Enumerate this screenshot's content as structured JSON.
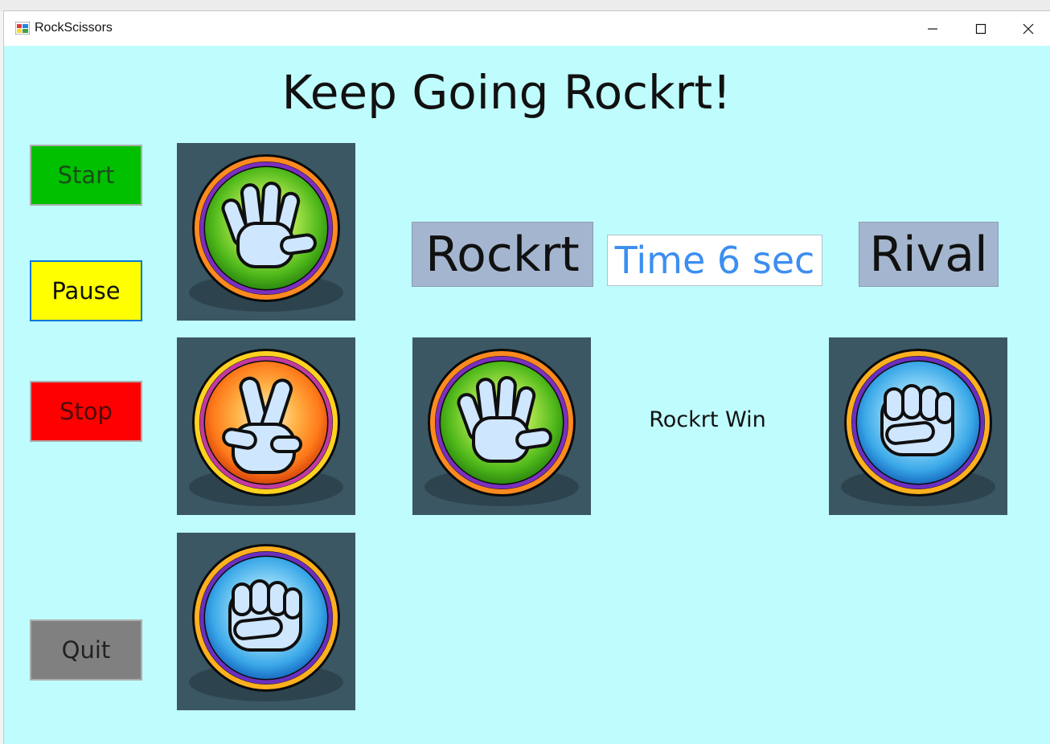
{
  "window": {
    "title": "RockScissors"
  },
  "heading": "Keep Going Rockrt!",
  "buttons": {
    "start": "Start",
    "pause": "Pause",
    "stop": "Stop",
    "quit": "Quit"
  },
  "scoreboard": {
    "player_name": "Rockrt",
    "timer": "Time 6 sec",
    "rival_name": "Rival"
  },
  "round": {
    "player_choice": "paper-hand-icon",
    "rival_choice": "rock-fist-icon",
    "result": "Rockrt Win"
  },
  "choices": [
    "paper-hand-icon",
    "scissors-hand-icon",
    "rock-fist-icon"
  ],
  "colors": {
    "client_background": "#bffcfd",
    "start_button": "#00c000",
    "pause_button": "#ffff00",
    "stop_button": "#ff0000",
    "quit_button": "#808080",
    "name_box": "#a4b6cf",
    "timer_text": "#3c8ef0",
    "tile_background": "#3b5763",
    "paper_ring": "#66cc22",
    "scissors_ring": "#ff7a1a",
    "rock_ring": "#3aa8e8"
  }
}
